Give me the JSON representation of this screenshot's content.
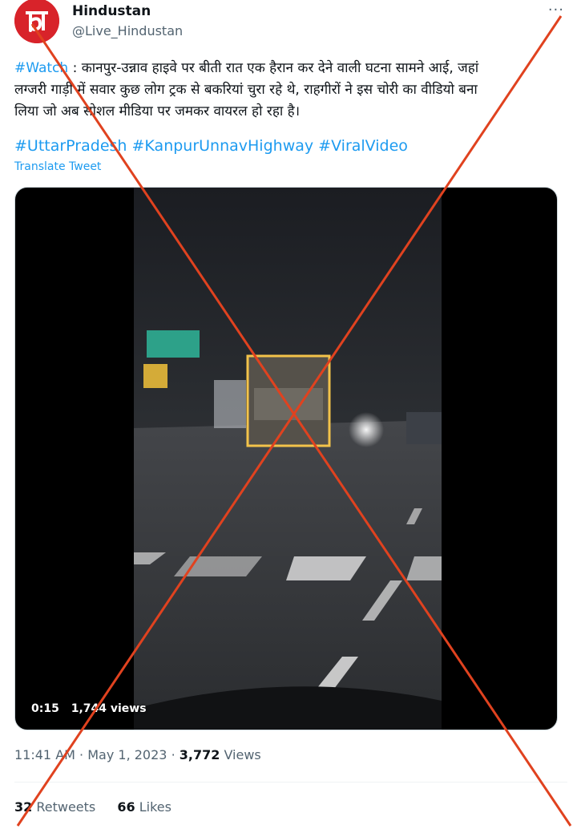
{
  "account": {
    "name": "Hindustan",
    "handle": "@Live_Hindustan",
    "avatar_icon": "hindustan-logo",
    "avatar_color": "#d8232a"
  },
  "more_icon": "more-options-icon",
  "more_glyph": "···",
  "tweet": {
    "watch_tag": "#Watch",
    "line1": " : कानपुर-उन्नाव हाइवे पर बीती रात एक हैरान कर देने वाली घटना सामने आई, जहां",
    "line2": "लग्जरी गाड़ी में सवार कुछ लोग ट्रक से बकरियां चुरा रहे थे, राहगीरों ने इस चोरी का वीडियो बना",
    "line3": "लिया जो अब सोशल मीडिया पर जमकर वायरल हो रहा है।",
    "hashtags": [
      "#UttarPradesh",
      "#KanpurUnnavHighway",
      "#ViralVideo"
    ],
    "translate_label": "Translate Tweet"
  },
  "video": {
    "duration": "0:15",
    "views": "1,744 views"
  },
  "meta": {
    "time": "11:41 AM",
    "separator": "·",
    "date": "May 1, 2023",
    "views_count": "3,772",
    "views_label": "Views"
  },
  "stats": {
    "retweets_count": "32",
    "retweets_label": "Retweets",
    "likes_count": "66",
    "likes_label": "Likes"
  },
  "colors": {
    "link": "#1d9bf0",
    "cross": "#e0421f",
    "secondary_text": "#536471"
  }
}
